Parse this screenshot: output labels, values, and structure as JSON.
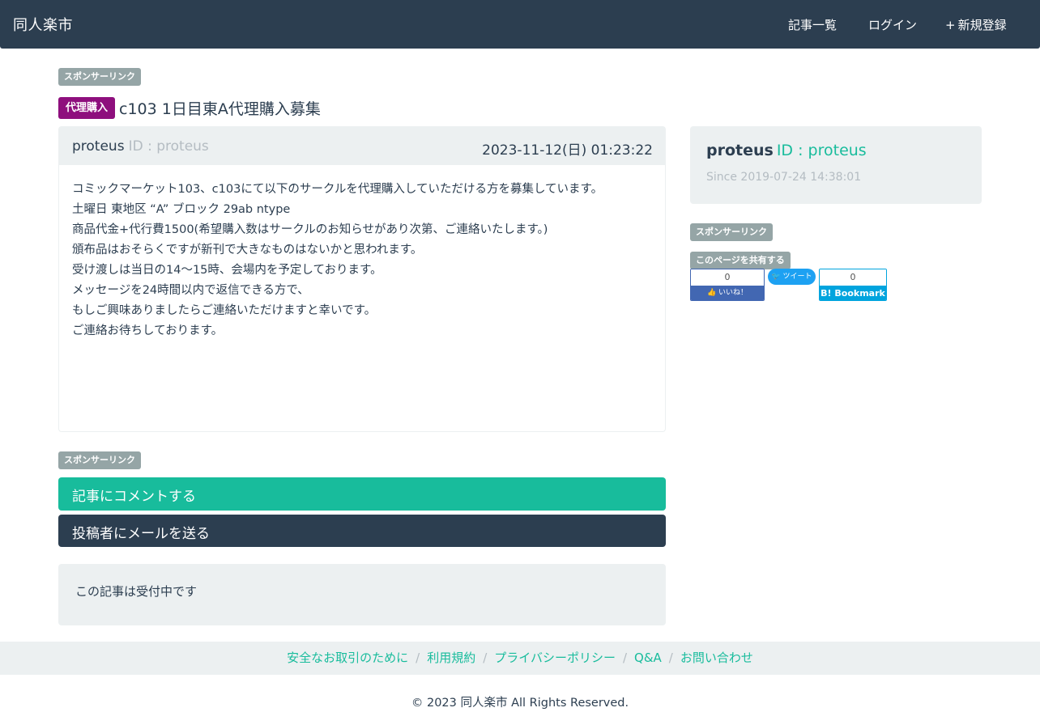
{
  "header": {
    "brand": "同人楽市",
    "nav": [
      {
        "icon": "list-icon",
        "glyph": "",
        "label": "記事一覧"
      },
      {
        "icon": "login-icon",
        "glyph": "",
        "label": "ログイン"
      },
      {
        "icon": "plus-icon",
        "glyph": "+",
        "label": "新規登録"
      }
    ]
  },
  "sponsor_label": "スポンサーリンク",
  "article": {
    "category": "代理購入",
    "title": "c103 1日目東A代理購入募集",
    "author": "proteus",
    "author_id": "ID : proteus",
    "date": "2023-11-12(日) 01:23:22",
    "body_lines": [
      "コミックマーケット103、c103にて以下のサークルを代理購入していただける方を募集しています。",
      "",
      "土曜日 東地区 “A” ブロック 29ab ntype",
      "",
      "商品代金+代行費1500(希望購入数はサークルのお知らせがあり次第、ご連絡いたします。)",
      "",
      "頒布品はおそらくですが新刊で大きなものはないかと思われます。",
      "受け渡しは当日の14〜15時、会場内を予定しております。",
      "",
      "メッセージを24時間以内で返信できる方で、",
      "もしご興味ありましたらご連絡いただけますと幸いです。",
      "ご連絡お待ちしております。"
    ]
  },
  "actions": {
    "comment": "記事にコメントする",
    "mail": "投稿者にメールを送る"
  },
  "status": "この記事は受付中です",
  "sidebar": {
    "user": "proteus",
    "user_id": "ID : proteus",
    "since": "Since 2019-07-24 14:38:01",
    "share_label": "このページを共有する",
    "facebook": {
      "count": "0",
      "label": "いいね！"
    },
    "twitter": {
      "label": "ツイート"
    },
    "hatena": {
      "count": "0",
      "label": "B! Bookmark"
    }
  },
  "footer": {
    "links": [
      "安全なお取引のために",
      "利用規約",
      "プライバシーポリシー",
      "Q&A",
      "お問い合わせ"
    ],
    "copyright": "© 2023 同人楽市 All Rights Reserved."
  }
}
